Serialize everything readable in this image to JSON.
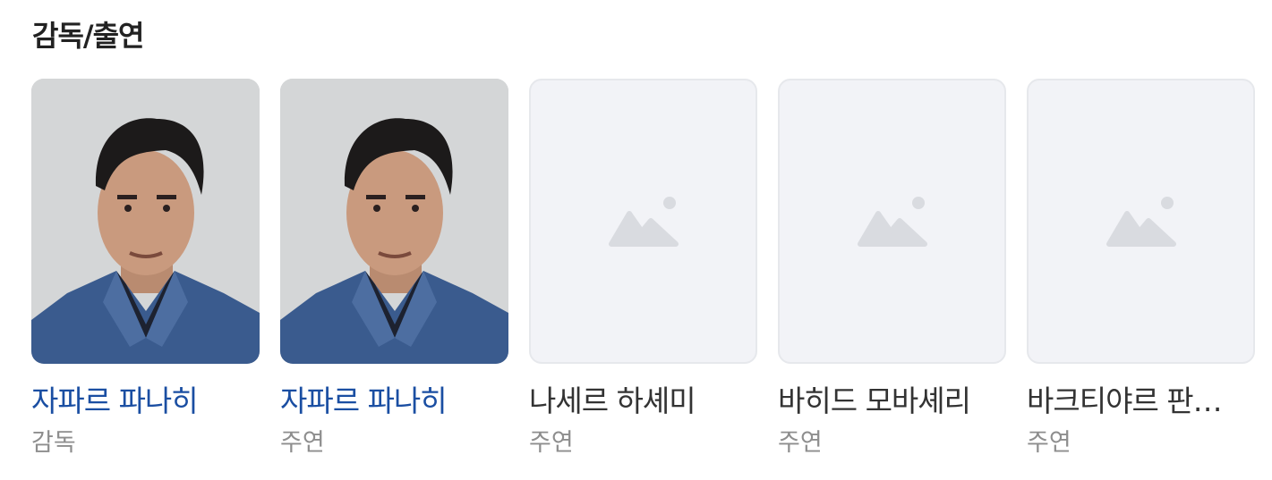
{
  "section": {
    "title": "감독/출연"
  },
  "cast": [
    {
      "name": "자파르 파나히",
      "role": "감독",
      "has_photo": true,
      "linked": true
    },
    {
      "name": "자파르 파나히",
      "role": "주연",
      "has_photo": true,
      "linked": true
    },
    {
      "name": "나세르 하셰미",
      "role": "주연",
      "has_photo": false,
      "linked": false
    },
    {
      "name": "바히드 모바셰리",
      "role": "주연",
      "has_photo": false,
      "linked": false
    },
    {
      "name": "바크티야르 판…",
      "role": "주연",
      "has_photo": false,
      "linked": false
    }
  ],
  "colors": {
    "link_name": "#1a4ea2",
    "plain_name": "#333333",
    "role": "#8e8e8e",
    "placeholder_bg": "#f2f3f7",
    "placeholder_icon": "#d9dbe0"
  }
}
